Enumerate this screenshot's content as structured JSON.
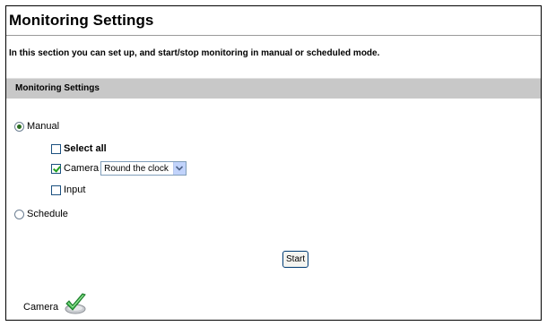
{
  "page": {
    "title": "Monitoring Settings",
    "intro": "In this section you can set up, and start/stop monitoring in manual or scheduled mode."
  },
  "section": {
    "header": "Monitoring Settings"
  },
  "mode": {
    "manual_label": "Manual",
    "schedule_label": "Schedule",
    "selected": "Manual"
  },
  "manual": {
    "select_all_label": "Select all",
    "select_all_checked": false,
    "camera_label": "Camera",
    "camera_checked": true,
    "camera_schedule_value": "Round the clock",
    "input_label": "Input",
    "input_checked": false
  },
  "actions": {
    "start_label": "Start"
  },
  "status": {
    "camera_label": "Camera",
    "icon": "green-checkmark-icon"
  },
  "colors": {
    "header_bg": "#c8c8c8",
    "check": "#21a121"
  }
}
